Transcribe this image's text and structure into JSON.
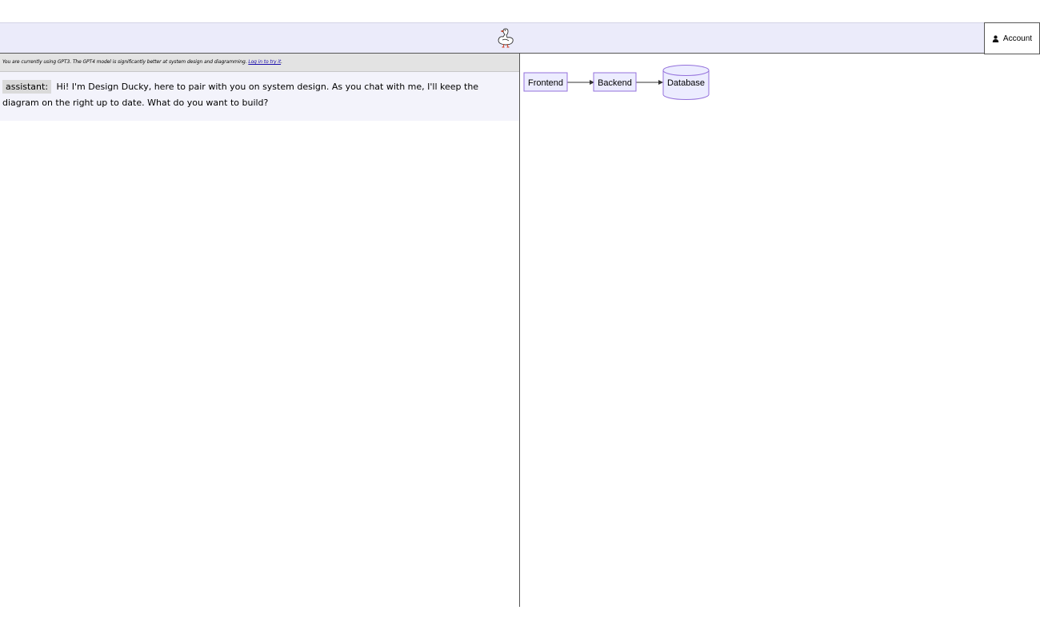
{
  "header": {
    "logo_icon": "duck-icon",
    "account_icon": "user-icon",
    "account_label": "Account"
  },
  "notice": {
    "text": "You are currently using GPT3. The GPT4 model is significantly better at system design and diagramming. ",
    "link_label": "Log in to try it",
    "suffix": "."
  },
  "chat": {
    "messages": [
      {
        "role": "assistant:",
        "text": "Hi! I'm Design Ducky, here to pair with you on system design. As you chat with me, I'll keep the diagram on the right up to date. What do you want to build?"
      }
    ]
  },
  "diagram": {
    "nodes": [
      {
        "label": "Frontend",
        "shape": "rect"
      },
      {
        "label": "Backend",
        "shape": "rect"
      },
      {
        "label": "Database",
        "shape": "cylinder"
      }
    ],
    "edges": [
      {
        "from": "Frontend",
        "to": "Backend"
      },
      {
        "from": "Backend",
        "to": "Database"
      }
    ],
    "colors": {
      "node_fill": "#ececff",
      "node_stroke": "#9370db",
      "edge": "#333333"
    }
  }
}
